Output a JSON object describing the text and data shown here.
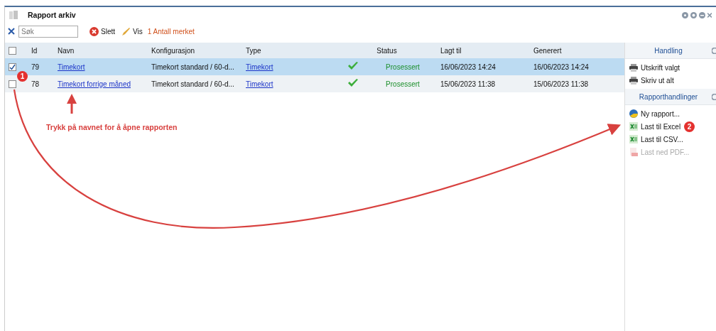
{
  "window": {
    "title": "Rapport arkiv"
  },
  "toolbar": {
    "search": {
      "placeholder": "Søk"
    },
    "buttons": [
      {
        "kind": "delete",
        "label": "Slett"
      },
      {
        "kind": "view",
        "label": "Vis"
      }
    ],
    "selection_count": "1 Antall merket"
  },
  "table": {
    "select_all": {
      "checked": false
    },
    "columns": [
      "Id",
      "Navn",
      "Konfigurasjon",
      "Type",
      "Status",
      "Lagt til",
      "Generert"
    ],
    "rows": [
      {
        "selected": true,
        "checked": true,
        "id": "79",
        "name": "Timekort",
        "configuration": "Timekort standard / 60-d...",
        "type": "Timekort",
        "status": "Prosessert",
        "added": "16/06/2023 14:24",
        "generated": "16/06/2023 14:24"
      },
      {
        "selected": false,
        "checked": false,
        "id": "78",
        "name": "Timekort forrige måned",
        "configuration": "Timekort standard / 60-d...",
        "type": "Timekort",
        "status": "Prosessert",
        "added": "15/06/2023 11:38",
        "generated": "15/06/2023 11:38"
      }
    ]
  },
  "side_panel": {
    "sections": [
      {
        "title": "Handling",
        "items": [
          {
            "kind": "printer",
            "label": "Utskrift valgt",
            "disabled": false
          },
          {
            "kind": "printer",
            "label": "Skriv ut alt",
            "disabled": false
          }
        ]
      },
      {
        "title": "Rapporthandlinger",
        "items": [
          {
            "kind": "chart",
            "label": "Ny rapport...",
            "disabled": false
          },
          {
            "kind": "excel",
            "label": "Last til Excel",
            "disabled": false
          },
          {
            "kind": "excel",
            "label": "Last til CSV...",
            "disabled": false
          },
          {
            "kind": "pdf",
            "label": "Last ned PDF...",
            "disabled": true
          }
        ]
      }
    ]
  },
  "annotations": {
    "hint": "Trykk på navnet for å åpne rapporten",
    "badges": [
      "1",
      "2"
    ]
  }
}
